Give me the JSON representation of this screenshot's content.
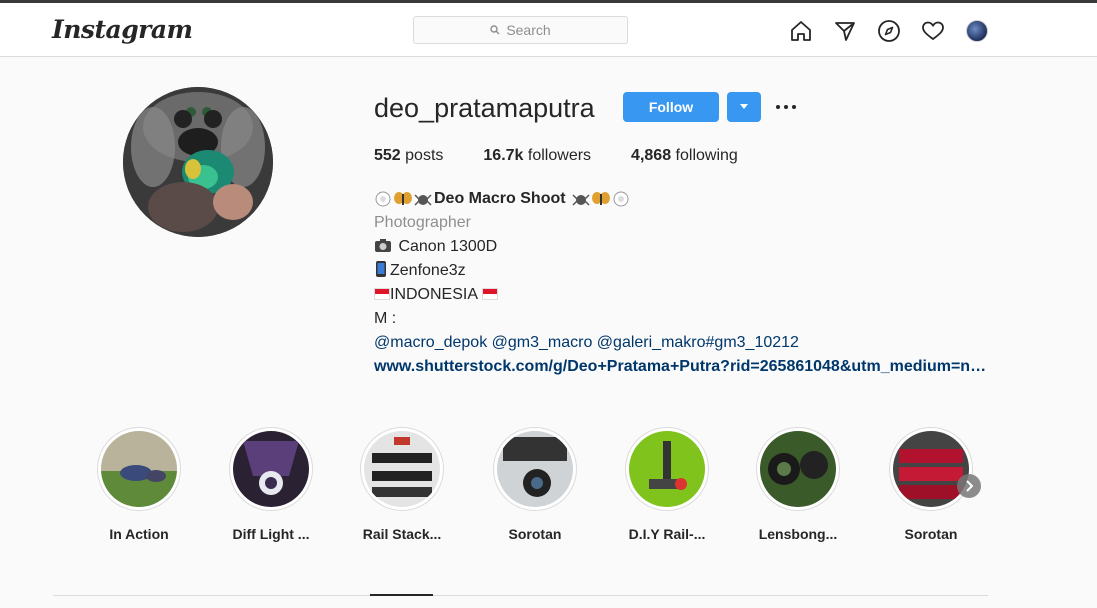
{
  "app": {
    "logo": "Instagram"
  },
  "search": {
    "placeholder": "Search"
  },
  "nav_icons": [
    "home-icon",
    "direct-icon",
    "explore-icon",
    "activity-heart-icon",
    "profile-avatar"
  ],
  "profile": {
    "username": "deo_pratamaputra",
    "follow_label": "Follow",
    "stats": {
      "posts_count": "552",
      "posts_label": "posts",
      "followers_count": "16.7k",
      "followers_label": "followers",
      "following_count": "4,868",
      "following_label": "following"
    },
    "bio": {
      "name": "Deo Macro Shoot",
      "category": "Photographer",
      "line1": "Canon 1300D",
      "line2": "Zenfone3z",
      "line3": "INDONESIA",
      "line4": "M :",
      "mentions": "@macro_depok @gm3_macro @galeri_makro#gm3_10212",
      "link": "www.shutterstock.com/g/Deo+Pratama+Putra?rid=265861048&utm_medium=n…"
    }
  },
  "highlights": [
    {
      "label": "In Action"
    },
    {
      "label": "Diff Light ..."
    },
    {
      "label": "Rail Stack..."
    },
    {
      "label": "Sorotan"
    },
    {
      "label": "D.I.Y Rail-..."
    },
    {
      "label": "Lensbong..."
    },
    {
      "label": "Sorotan"
    }
  ],
  "colors": {
    "accent": "#3897f0",
    "link": "#00376b",
    "muted": "#8e8e8e"
  }
}
